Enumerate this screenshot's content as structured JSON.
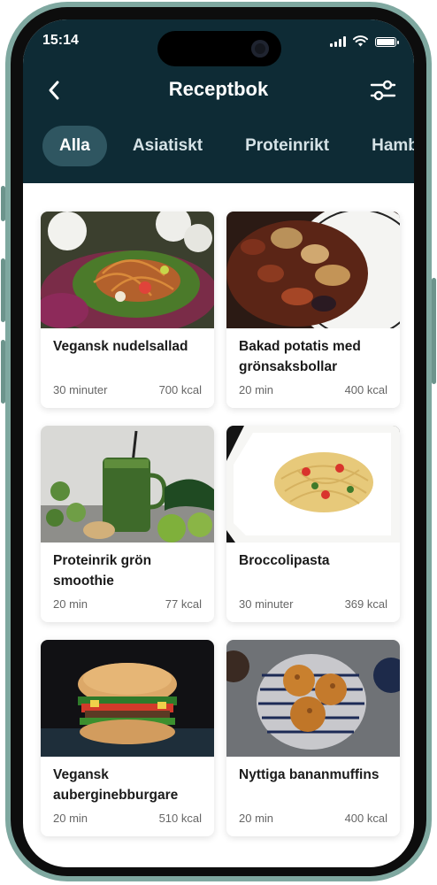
{
  "status": {
    "time": "15:14"
  },
  "header": {
    "title": "Receptbok",
    "back_icon": "chevron-left-icon",
    "filter_icon": "sliders-icon"
  },
  "tabs": [
    {
      "label": "Alla",
      "active": true
    },
    {
      "label": "Asiatiskt",
      "active": false
    },
    {
      "label": "Proteinrikt",
      "active": false
    },
    {
      "label": "Hamburgare",
      "active": false
    }
  ],
  "recipes": [
    {
      "title": "Vegansk nudelsallad",
      "time": "30 minuter",
      "kcal": "700 kcal",
      "image": "noodle-salad-photo"
    },
    {
      "title": "Bakad potatis med grönsaksbollar",
      "time": "20 min",
      "kcal": "400 kcal",
      "image": "roasted-potatoes-photo"
    },
    {
      "title": "Proteinrik grön smoothie",
      "time": "20 min",
      "kcal": "77 kcal",
      "image": "green-smoothie-photo"
    },
    {
      "title": "Broccolipasta",
      "time": "30 minuter",
      "kcal": "369 kcal",
      "image": "pasta-photo"
    },
    {
      "title": "Vegansk auberginebburgare",
      "time": "20 min",
      "kcal": "510 kcal",
      "image": "burger-photo"
    },
    {
      "title": "Nyttiga bananmuffins",
      "time": "20 min",
      "kcal": "400 kcal",
      "image": "muffins-photo"
    }
  ],
  "colors": {
    "header_bg": "#0e2b35",
    "active_tab_bg": "#2f5661",
    "phone_frame": "#7fa8a0"
  }
}
